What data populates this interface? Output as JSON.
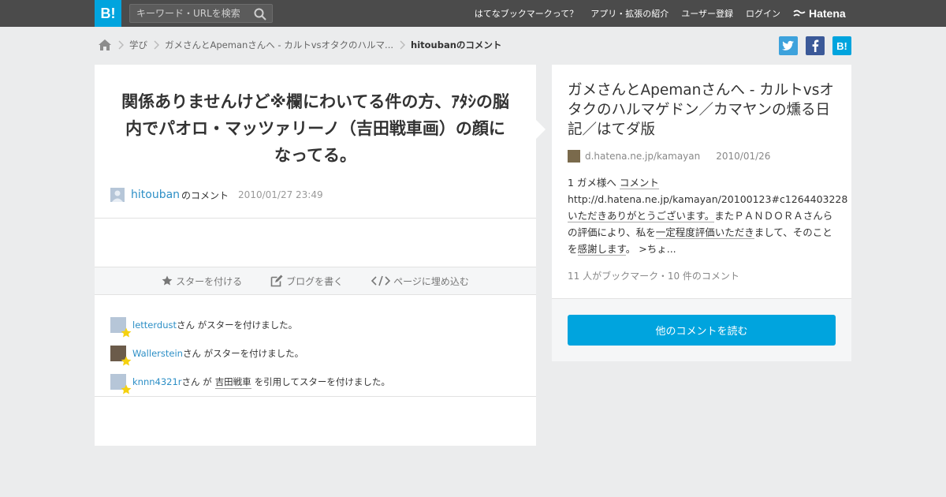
{
  "header": {
    "logo_text": "B!",
    "search_placeholder": "キーワード・URLを検索",
    "nav": [
      "はてなブックマークって？",
      "アプリ・拡張の紹介",
      "ユーザー登録",
      "ログイン"
    ],
    "brand": "Hatena"
  },
  "breadcrumb": {
    "items": [
      "学び",
      "ガメさんとApemanさんへ - カルトvsオタクのハルマ..."
    ],
    "current": "hitoubanのコメント"
  },
  "share": {
    "twitter_label": "t",
    "facebook_label": "f",
    "hatena_label": "B!",
    "colors": {
      "twitter": "#3da2dc",
      "facebook": "#3b5998",
      "hatena": "#00a4de"
    }
  },
  "comment": {
    "text": "関係ありませんけど※欄にわいてる件の方、ｱﾀｼの脳内でパオロ・マッツァリーノ（吉田戦車画）の顔になってる。",
    "user": "hitouban",
    "user_suffix": "のコメント",
    "date": "2010/01/27 23:49"
  },
  "actions": {
    "star": "スターを付ける",
    "blog": "ブログを書く",
    "embed": "ページに埋め込む"
  },
  "stars": [
    {
      "name": "letterdust",
      "prefix": "さん がスターを付けました。",
      "quote": "",
      "suffix": ""
    },
    {
      "name": "Wallerstein",
      "prefix": "さん がスターを付けました。",
      "quote": "",
      "suffix": ""
    },
    {
      "name": "knnn4321r",
      "prefix": "さん が",
      "quote": "吉田戦車",
      "suffix": "を引用してスターを付けました。"
    }
  ],
  "entry": {
    "title": "ガメさんとApemanさんへ - カルトvsオタクのハルマゲドン／カマヤンの燻る日記／はてダ版",
    "domain": "d.hatena.ne.jp/kamayan",
    "date": "2010/01/26",
    "summary_1": "1 ガメ様へ ",
    "summary_2": "コメント",
    "summary_3": " http://d.hatena.ne.jp/kamayan/20100123#c1264403228",
    "summary_4": "いただきありがとうございます。",
    "summary_5": "またＰＡＮＤＯＲＡさんらの評価により、私を",
    "summary_6": "一定程度評価いただき",
    "summary_7": "まして、そのことを",
    "summary_8": "感謝します",
    "summary_9": "。 >ちょ...",
    "count": "11 人がブックマーク・10 件のコメント",
    "read_button": "他のコメントを読む"
  }
}
